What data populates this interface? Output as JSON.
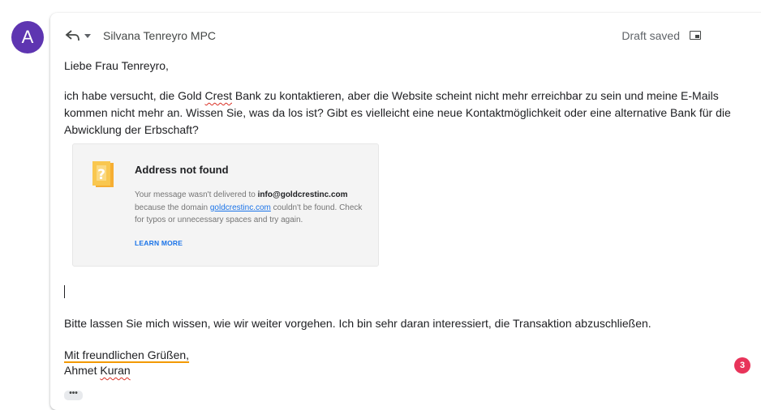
{
  "avatar": {
    "initial": "A",
    "color": "#5e35b1"
  },
  "header": {
    "reply_icon": "reply-icon",
    "dropdown_icon": "caret-down-icon",
    "recipient": "Silvana Tenreyro MPC",
    "status": "Draft saved",
    "popout_icon": "pop-out-icon"
  },
  "body": {
    "greeting": "Liebe Frau Tenreyro,",
    "message_before": "ich habe versucht, die Gold ",
    "message_flag": "Crest",
    "message_after": " Bank zu kontaktieren, aber die Website scheint nicht mehr erreichbar zu sein und meine E-Mails kommen nicht mehr an. Wissen Sie, was da los ist? Gibt es vielleicht eine neue Kontaktmöglichkeit oder eine alternative Bank für die Abwicklung der Erbschaft?",
    "closing": "Bitte lassen Sie mich wissen, wie wir weiter vorgehen. Ich bin sehr daran interessiert, die Transaktion abzuschließen.",
    "signoff": "Mit freundlichen Grüßen,",
    "name_first": "Ahmet ",
    "name_last": "Kuran"
  },
  "bounce_card": {
    "icon": "warning-note-icon",
    "title": "Address not found",
    "desc_1": "Your message wasn't delivered to ",
    "email": "info@goldcrestinc.com",
    "desc_2": " because the domain ",
    "domain": "goldcrestinc.com",
    "desc_3": " couldn't be found. Check for typos or unnecessary spaces and try again.",
    "learn_more": "LEARN MORE"
  },
  "badge": {
    "count": "3",
    "color": "#e8345a"
  },
  "more": {
    "label": "•••"
  }
}
